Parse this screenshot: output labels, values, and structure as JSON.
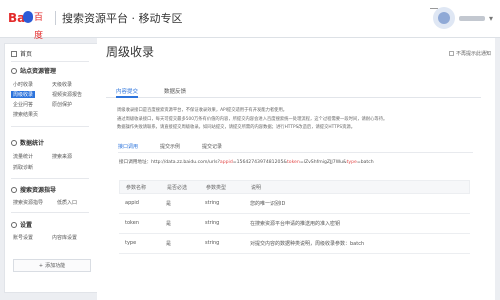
{
  "header": {
    "logo_text_1": "Bai",
    "logo_text_2": "百度",
    "title": "搜索资源平台 · 移动专区"
  },
  "sidebar": {
    "home": "首页",
    "sections": [
      {
        "title": "站点资源管理",
        "items": [
          "小时收录",
          "天级收录",
          "周级收录",
          "视频资源报告",
          "企业问答",
          "原创保护",
          "搜索结果页"
        ]
      },
      {
        "title": "数据统计",
        "items": [
          "流量统计",
          "搜索来源",
          "抓取诊断"
        ]
      },
      {
        "title": "搜索资源指导",
        "items": [
          "搜索资源指导",
          "低质入口"
        ]
      },
      {
        "title": "设置",
        "items": [
          "账号设置",
          "内容库设置"
        ]
      }
    ],
    "add_button": "添加功能"
  },
  "main": {
    "title": "周级收录",
    "hide_notice": "不再提示此通知",
    "tabs": [
      "内容提交",
      "数据反馈"
    ],
    "description": [
      "周级收录接口是百度搜索资源平台，不保证收录效果，API提交适用于有开发能力者使用。",
      "通过周级收录接口，每天可提交最多500万条有价值的内容，所提交内容会进入百度搜索统一处理流程，这个过程需要一段时间，请耐心等待。",
      "数据操作失败请联系，请直接提交周级收录。如同站提交，请提交所需的内容数据；进行HTTPS改造后，请提交HTTPS资源。"
    ],
    "subtabs": [
      "接口调用",
      "提交示例",
      "提交记录"
    ],
    "api": {
      "label": "接口调用地址：",
      "host": "http://data.zz.baidu.com/urls?",
      "p_appid": "appid",
      "v_appid": "=1564274397481205&",
      "p_token": "token",
      "v_token": "=lZvShfmigZJJ7Wu&",
      "p_type": "type",
      "v_type": "=batch"
    },
    "table": {
      "headers": [
        "参数名称",
        "是否必选",
        "参数类型",
        "说明"
      ],
      "rows": [
        [
          "appid",
          "是",
          "string",
          "您的唯一识别ID"
        ],
        [
          "token",
          "是",
          "string",
          "在搜索资源平台申请的推送用的准入密钥"
        ],
        [
          "type",
          "是",
          "string",
          "对提交内容的数据种类说明，周级收录参数：batch"
        ]
      ]
    }
  }
}
